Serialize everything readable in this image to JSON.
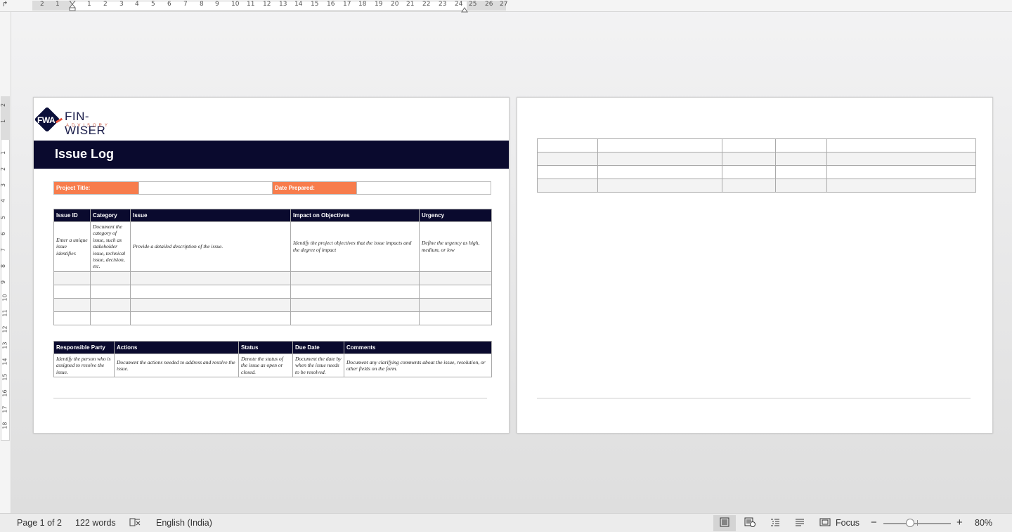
{
  "ruler": {
    "h_numbers": [
      "2",
      "1",
      "1",
      "2",
      "3",
      "4",
      "5",
      "6",
      "7",
      "8",
      "9",
      "10",
      "11",
      "12",
      "13",
      "14",
      "15",
      "16",
      "17",
      "18",
      "19",
      "20",
      "21",
      "22",
      "23",
      "24",
      "25",
      "26",
      "27"
    ],
    "v_numbers": [
      "2",
      "1",
      "1",
      "2",
      "3",
      "4",
      "5",
      "6",
      "7",
      "8",
      "9",
      "10",
      "11",
      "12",
      "13",
      "14",
      "15",
      "16",
      "17",
      "18"
    ]
  },
  "logo": {
    "mark": "FWA",
    "name": "FIN-WISER",
    "tagline": "ADVISORY"
  },
  "document": {
    "title": "Issue Log",
    "project_title_label": "Project Title:",
    "project_title_value": "",
    "date_prepared_label": "Date Prepared:",
    "date_prepared_value": "",
    "issue_table": {
      "headers": [
        "Issue ID",
        "Category",
        "Issue",
        "Impact on Objectives",
        "Urgency"
      ],
      "guide_row": [
        "Enter a unique issue identifier.",
        "Document the category of issue, such as stakeholder issue, technical issue, decision, etc.",
        "Provide a detailed description of the issue.",
        "Identify the project objectives that the issue impacts and the degree of impact",
        "Define the urgency as high, medium, or low"
      ],
      "empty_rows": 4
    },
    "action_table": {
      "headers": [
        "Responsible Party",
        "Actions",
        "Status",
        "Due Date",
        "Comments"
      ],
      "guide_row": [
        "Identify the person who is assigned to resolve the issue.",
        "Document the actions needed to address and resolve the issue.",
        "Denote the status of the issue as open or closed.",
        "Document the date by when the issue needs to be resolved.",
        "Document any clarifying comments about the issue, resolution, or other fields on the form."
      ]
    }
  },
  "statusbar": {
    "page": "Page 1 of 2",
    "words": "122 words",
    "language": "English (India)",
    "focus": "Focus",
    "zoom": "80%",
    "zoom_minus": "−",
    "zoom_plus": "+"
  }
}
